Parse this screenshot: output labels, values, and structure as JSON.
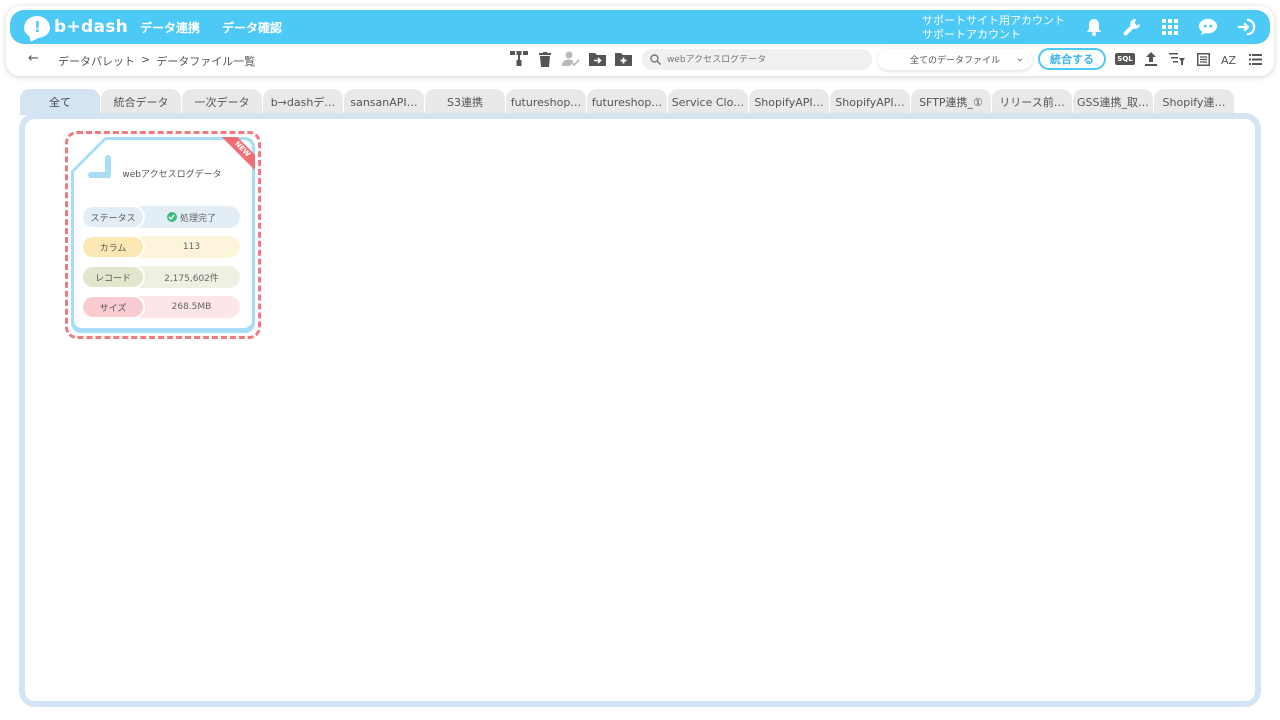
{
  "app": {
    "logo_text": "b+dash",
    "logo_mark": "!"
  },
  "nav": [
    {
      "label": "データ連携"
    },
    {
      "label": "データ確認"
    }
  ],
  "account": {
    "line1": "サポートサイト用アカウント",
    "line2": "サポートアカウント"
  },
  "top_icons": [
    "bell-icon",
    "wrench-icon",
    "grid-icon",
    "chat-icon",
    "logout-icon"
  ],
  "breadcrumb": {
    "back": "←",
    "items": [
      "データパレット",
      "データファイル一覧"
    ],
    "separator": ">"
  },
  "search": {
    "value": "",
    "placeholder": "webアクセスログデータ"
  },
  "file_filter": {
    "selected": "全てのデータファイル"
  },
  "merge_button": "統合する",
  "sql_label": "SQL",
  "tabs": [
    "全て",
    "統合データ",
    "一次データ",
    "b→dashデ…",
    "sansanAPI…",
    "S3連携",
    "futureshop…",
    "futureshop…",
    "Service Clo…",
    "ShopifyAPI…",
    "ShopifyAPI…",
    "SFTP連携_①",
    "リリース前…",
    "GSS連携_取…",
    "Shopify連…"
  ],
  "card": {
    "title": "webアクセスログデータ",
    "badge": "NEW",
    "rows": {
      "status": {
        "label": "ステータス",
        "value": "処理完了"
      },
      "columns": {
        "label": "カラム",
        "value": "113"
      },
      "records": {
        "label": "レコード",
        "value": "2,175,602件"
      },
      "size": {
        "label": "サイズ",
        "value": "268.5MB"
      }
    }
  },
  "colors": {
    "accent": "#4dc9f6",
    "panel_border": "#d4e4f2",
    "new_badge": "#ef6f74",
    "status_ok": "#3cbf7d"
  }
}
